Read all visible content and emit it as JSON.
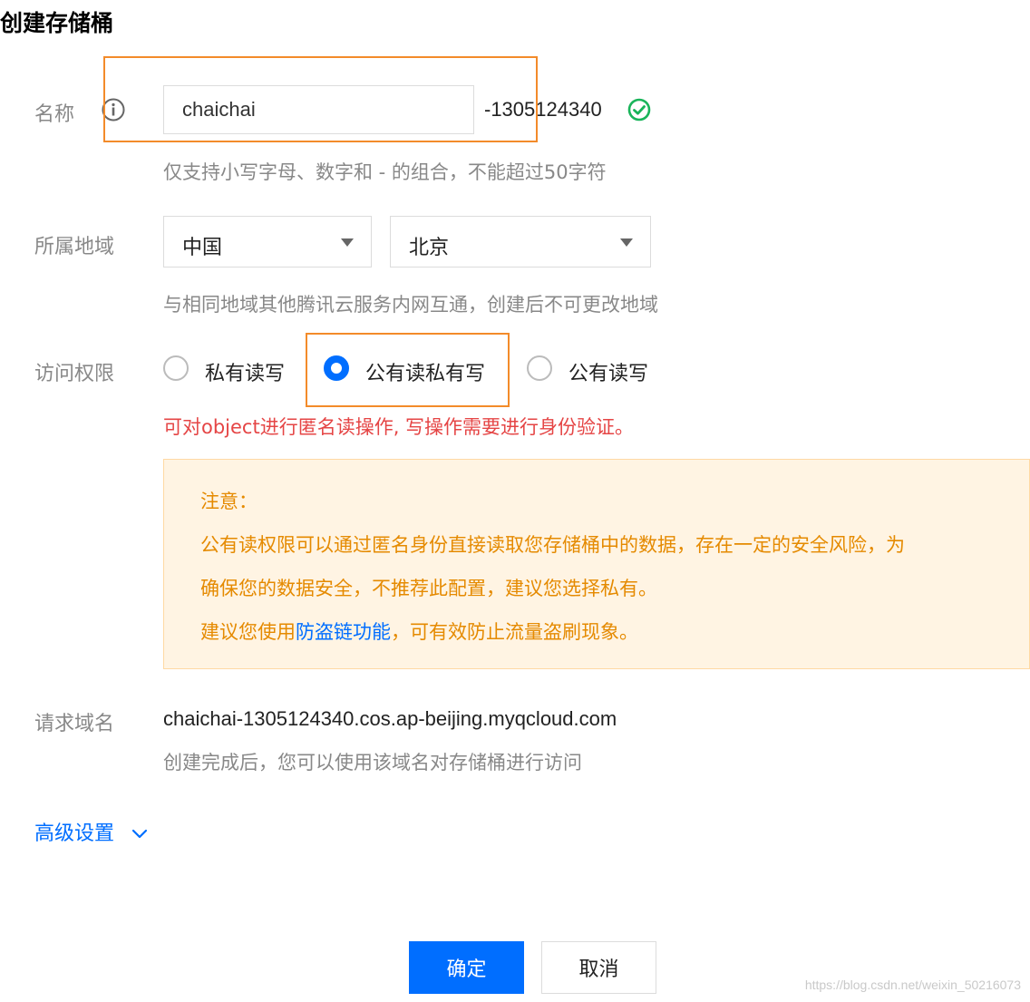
{
  "page": {
    "title": "创建存储桶"
  },
  "name_field": {
    "label": "名称",
    "value": "chaichai",
    "suffix": "-1305124340",
    "hint": "仅支持小写字母、数字和 - 的组合，不能超过50字符"
  },
  "region": {
    "label": "所属地域",
    "country": "中国",
    "city": "北京",
    "hint": "与相同地域其他腾讯云服务内网互通，创建后不可更改地域"
  },
  "access": {
    "label": "访问权限",
    "options": [
      {
        "label": "私有读写",
        "selected": false
      },
      {
        "label": "公有读私有写",
        "selected": true
      },
      {
        "label": "公有读写",
        "selected": false
      }
    ],
    "note": "可对object进行匿名读操作, 写操作需要进行身份验证。"
  },
  "warning": {
    "title": "注意：",
    "line1": "公有读权限可以通过匿名身份直接读取您存储桶中的数据，存在一定的安全风险，为",
    "line2": "确保您的数据安全，不推荐此配置，建议您选择私有。",
    "line3_prefix": "建议您使用",
    "line3_link": "防盗链功能",
    "line3_suffix": "，可有效防止流量盗刷现象。"
  },
  "request_domain": {
    "label": "请求域名",
    "value": "chaichai-1305124340.cos.ap-beijing.myqcloud.com",
    "hint": "创建完成后，您可以使用该域名对存储桶进行访问"
  },
  "advanced": {
    "label": "高级设置"
  },
  "buttons": {
    "confirm": "确定",
    "cancel": "取消"
  },
  "watermark": "https://blog.csdn.net/weixin_50216073",
  "colors": {
    "primary": "#006eff",
    "highlight": "#f38b2a",
    "warning_text": "#e58a00",
    "warning_bg": "#fff4e3",
    "error": "#e54545",
    "success": "#19b45a"
  }
}
